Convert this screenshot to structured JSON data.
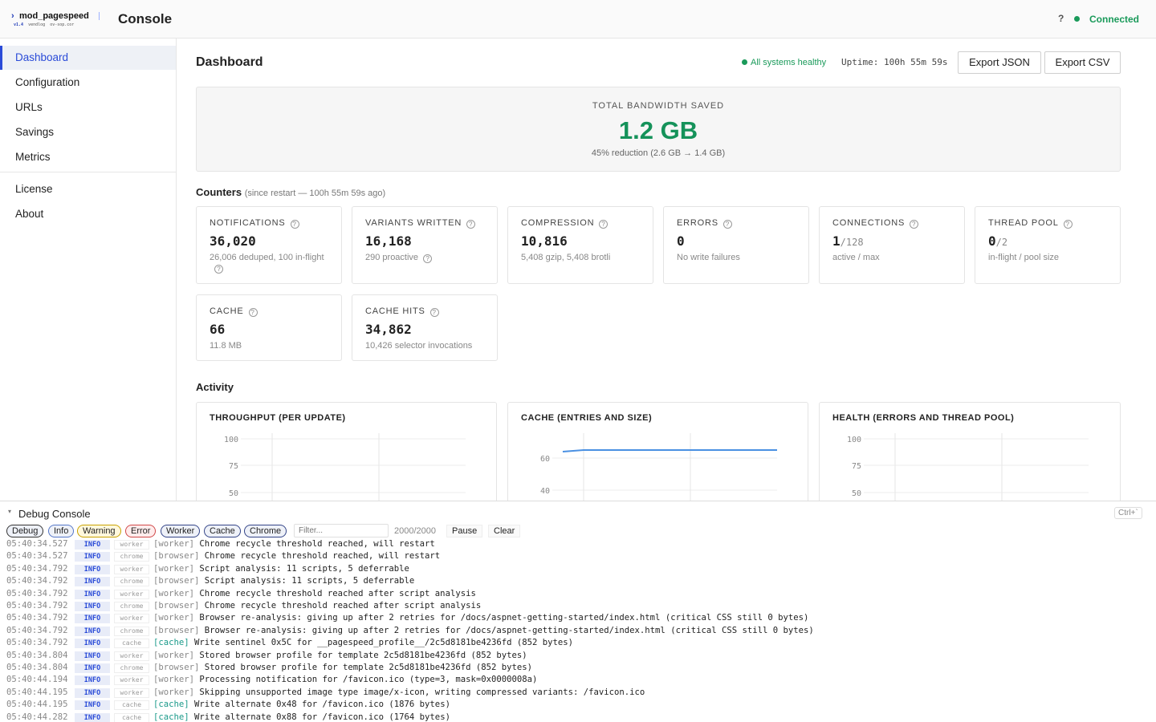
{
  "topbar": {
    "logo_name": "mod_pagespeed",
    "logo_version": "v1.4",
    "logo_sub1": "vendlog",
    "logo_sub2": "ov-sop.cor",
    "title": "Console",
    "help_glyph": "?",
    "connection_status": "Connected",
    "connection_color": "#1a9a5a"
  },
  "sidebar": {
    "items": [
      {
        "label": "Dashboard",
        "active": true
      },
      {
        "label": "Configuration"
      },
      {
        "label": "URLs"
      },
      {
        "label": "Savings"
      },
      {
        "label": "Metrics"
      }
    ],
    "secondary": [
      {
        "label": "License"
      },
      {
        "label": "About"
      }
    ]
  },
  "header": {
    "title": "Dashboard",
    "health": "All systems healthy",
    "uptime": "Uptime: 100h 55m 59s",
    "export_json": "Export JSON",
    "export_csv": "Export CSV"
  },
  "hero": {
    "label": "TOTAL BANDWIDTH SAVED",
    "value": "1.2 GB",
    "sub": "45% reduction (2.6 GB → 1.4 GB)",
    "accent": "#15925a"
  },
  "counters": {
    "title": "Counters",
    "subtitle": "(since restart — 100h 55m 59s ago)",
    "cards": [
      {
        "label": "NOTIFICATIONS",
        "value": "36,020",
        "suffix": "",
        "sub": "26,006 deduped, 100 in-flight",
        "help": true
      },
      {
        "label": "VARIANTS WRITTEN",
        "value": "16,168",
        "suffix": "",
        "sub": "290 proactive",
        "help": true
      },
      {
        "label": "COMPRESSION",
        "value": "10,816",
        "suffix": "",
        "sub": "5,408 gzip, 5,408 brotli",
        "help": false
      },
      {
        "label": "ERRORS",
        "value": "0",
        "suffix": "",
        "sub": "No write failures",
        "help": false
      },
      {
        "label": "CONNECTIONS",
        "value": "1",
        "suffix": "/128",
        "sub": "active / max",
        "help": false
      },
      {
        "label": "THREAD POOL",
        "value": "0",
        "suffix": "/2",
        "sub": "in-flight / pool size",
        "help": false
      },
      {
        "label": "CACHE",
        "value": "66",
        "suffix": "",
        "sub": "11.8 MB",
        "help": false
      },
      {
        "label": "CACHE HITS",
        "value": "34,862",
        "suffix": "",
        "sub": "10,426 selector invocations",
        "help": false
      }
    ]
  },
  "activity": {
    "title": "Activity",
    "charts": [
      {
        "title": "THROUGHPUT (PER UPDATE)",
        "ticks": [
          "100",
          "75",
          "50"
        ],
        "line_value": null
      },
      {
        "title": "CACHE (ENTRIES AND SIZE)",
        "ticks": [
          "60",
          "40"
        ],
        "line_value": 66
      },
      {
        "title": "HEALTH (ERRORS AND THREAD POOL)",
        "ticks": [
          "100",
          "75",
          "50"
        ],
        "line_value": null
      }
    ]
  },
  "console": {
    "title": "Debug Console",
    "shortcut": "Ctrl+`",
    "filters": [
      "Debug",
      "Info",
      "Warning",
      "Error",
      "Worker",
      "Cache",
      "Chrome"
    ],
    "filter_placeholder": "Filter...",
    "count": "2000/2000",
    "pause": "Pause",
    "clear": "Clear",
    "rows": [
      {
        "time": "05:40:34.527",
        "level": "INFO",
        "src": "worker",
        "tag": "[worker]",
        "msg": "Chrome recycle threshold reached, will restart"
      },
      {
        "time": "05:40:34.527",
        "level": "INFO",
        "src": "chrome",
        "tag": "[browser]",
        "msg": "Chrome recycle threshold reached, will restart"
      },
      {
        "time": "05:40:34.792",
        "level": "INFO",
        "src": "worker",
        "tag": "[worker]",
        "msg": "Script analysis: 11 scripts, 5 deferrable"
      },
      {
        "time": "05:40:34.792",
        "level": "INFO",
        "src": "chrome",
        "tag": "[browser]",
        "msg": "Script analysis: 11 scripts, 5 deferrable"
      },
      {
        "time": "05:40:34.792",
        "level": "INFO",
        "src": "worker",
        "tag": "[worker]",
        "msg": "Chrome recycle threshold reached after script analysis"
      },
      {
        "time": "05:40:34.792",
        "level": "INFO",
        "src": "chrome",
        "tag": "[browser]",
        "msg": "Chrome recycle threshold reached after script analysis"
      },
      {
        "time": "05:40:34.792",
        "level": "INFO",
        "src": "worker",
        "tag": "[worker]",
        "msg": "Browser re-analysis: giving up after 2 retries for /docs/aspnet-getting-started/index.html (critical CSS still 0 bytes)"
      },
      {
        "time": "05:40:34.792",
        "level": "INFO",
        "src": "chrome",
        "tag": "[browser]",
        "msg": "Browser re-analysis: giving up after 2 retries for /docs/aspnet-getting-started/index.html (critical CSS still 0 bytes)"
      },
      {
        "time": "05:40:34.792",
        "level": "INFO",
        "src": "cache",
        "tag": "[cache]",
        "msg": "Write sentinel 0x5C for __pagespeed_profile__/2c5d8181be4236fd (852 bytes)"
      },
      {
        "time": "05:40:34.804",
        "level": "INFO",
        "src": "worker",
        "tag": "[worker]",
        "msg": "Stored browser profile for template 2c5d8181be4236fd (852 bytes)"
      },
      {
        "time": "05:40:34.804",
        "level": "INFO",
        "src": "chrome",
        "tag": "[browser]",
        "msg": "Stored browser profile for template 2c5d8181be4236fd (852 bytes)"
      },
      {
        "time": "05:40:44.194",
        "level": "INFO",
        "src": "worker",
        "tag": "[worker]",
        "msg": "Processing notification for /favicon.ico (type=3, mask=0x0000008a)"
      },
      {
        "time": "05:40:44.195",
        "level": "INFO",
        "src": "worker",
        "tag": "[worker]",
        "msg": "Skipping unsupported image type image/x-icon, writing compressed variants: /favicon.ico"
      },
      {
        "time": "05:40:44.195",
        "level": "INFO",
        "src": "cache",
        "tag": "[cache]",
        "msg": "Write alternate 0x48 for /favicon.ico (1876 bytes)"
      },
      {
        "time": "05:40:44.282",
        "level": "INFO",
        "src": "cache",
        "tag": "[cache]",
        "msg": "Write alternate 0x88 for /favicon.ico (1764 bytes)"
      }
    ]
  }
}
